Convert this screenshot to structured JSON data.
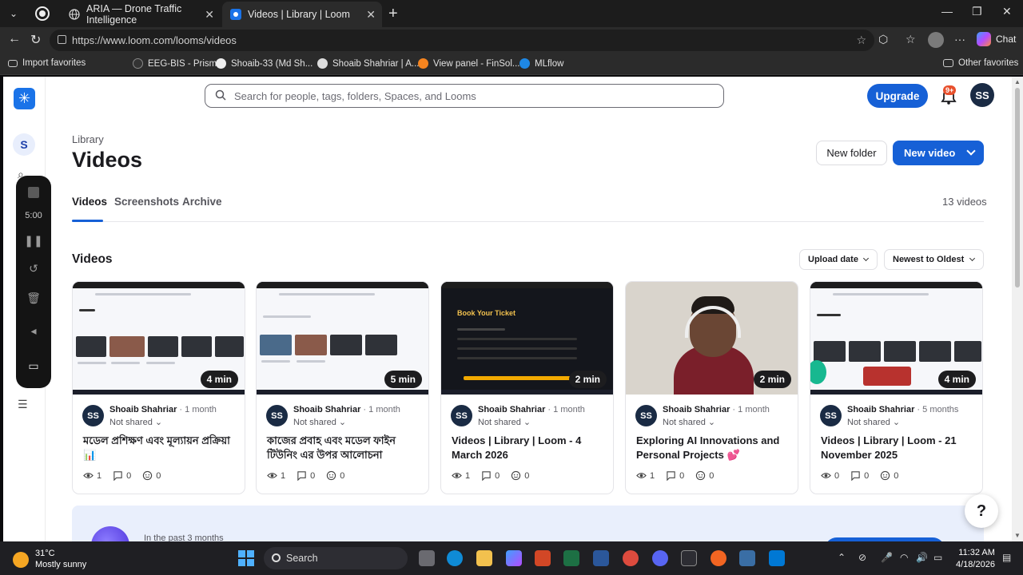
{
  "browser": {
    "tabs": [
      {
        "title": "ARIA — Drone Traffic Intelligence"
      },
      {
        "title": "Videos | Library | Loom"
      }
    ],
    "url": "https://www.loom.com/looms/videos",
    "chat_label": "Chat",
    "bookmarks": [
      {
        "label": "Import favorites"
      },
      {
        "label": "EEG-BIS - Prism"
      },
      {
        "label": "Shoaib-33 (Md Sh..."
      },
      {
        "label": "Shoaib Shahriar | A..."
      },
      {
        "label": "View panel - FinSol..."
      },
      {
        "label": "MLflow"
      }
    ],
    "other_favorites": "Other favorites"
  },
  "loom": {
    "workspace_initial": "S",
    "search_placeholder": "Search for people, tags, folders, Spaces, and Looms",
    "upgrade_label": "Upgrade",
    "notif_badge": "9+",
    "user_initials": "SS",
    "recorder_time": "5:00",
    "breadcrumb": "Library",
    "page_title": "Videos",
    "new_folder_label": "New folder",
    "new_video_label": "New video",
    "tabs": [
      {
        "label": "Videos"
      },
      {
        "label": "Screenshots"
      },
      {
        "label": "Archive"
      }
    ],
    "video_count": "13 videos",
    "section_title": "Videos",
    "sort_field": "Upload date",
    "sort_order": "Newest to Oldest",
    "cards": [
      {
        "duration": "4 min",
        "owner": "Shoaib Shahriar",
        "age": "· 1 month",
        "shared": "Not shared",
        "title": "মডেল প্রশিক্ষণ এবং মূল্যায়ন প্রক্রিয়া 📊",
        "views": "1",
        "comments": "0",
        "reactions": "0"
      },
      {
        "duration": "5 min",
        "owner": "Shoaib Shahriar",
        "age": "· 1 month",
        "shared": "Not shared",
        "title": "কাজের প্রবাহ এবং মডেল ফাইন টিউনিং এর উপর আলোচনা",
        "views": "1",
        "comments": "0",
        "reactions": "0"
      },
      {
        "duration": "2 min",
        "owner": "Shoaib Shahriar",
        "age": "· 1 month",
        "shared": "Not shared",
        "title": "Videos | Library | Loom - 4 March 2026",
        "views": "1",
        "comments": "0",
        "reactions": "0"
      },
      {
        "duration": "2 min",
        "owner": "Shoaib Shahriar",
        "age": "· 1 month",
        "shared": "Not shared",
        "title": "Exploring AI Innovations and Personal Projects 💕",
        "views": "1",
        "comments": "0",
        "reactions": "0"
      },
      {
        "duration": "4 min",
        "owner": "Shoaib Shahriar",
        "age": "· 5 months",
        "shared": "Not shared",
        "title": "Videos | Library | Loom - 21 November 2025",
        "views": "0",
        "comments": "0",
        "reactions": "0"
      }
    ],
    "thumb_ticket_text": "Book Your Ticket",
    "banner_text": "In the past 3 months",
    "help_label": "?"
  },
  "taskbar": {
    "temperature": "31°C",
    "weather": "Mostly sunny",
    "search_label": "Search",
    "time": "11:32 AM",
    "date": "4/18/2026"
  },
  "colors": {
    "brand_blue": "#1660d6",
    "badge_orange": "#e8502c"
  }
}
